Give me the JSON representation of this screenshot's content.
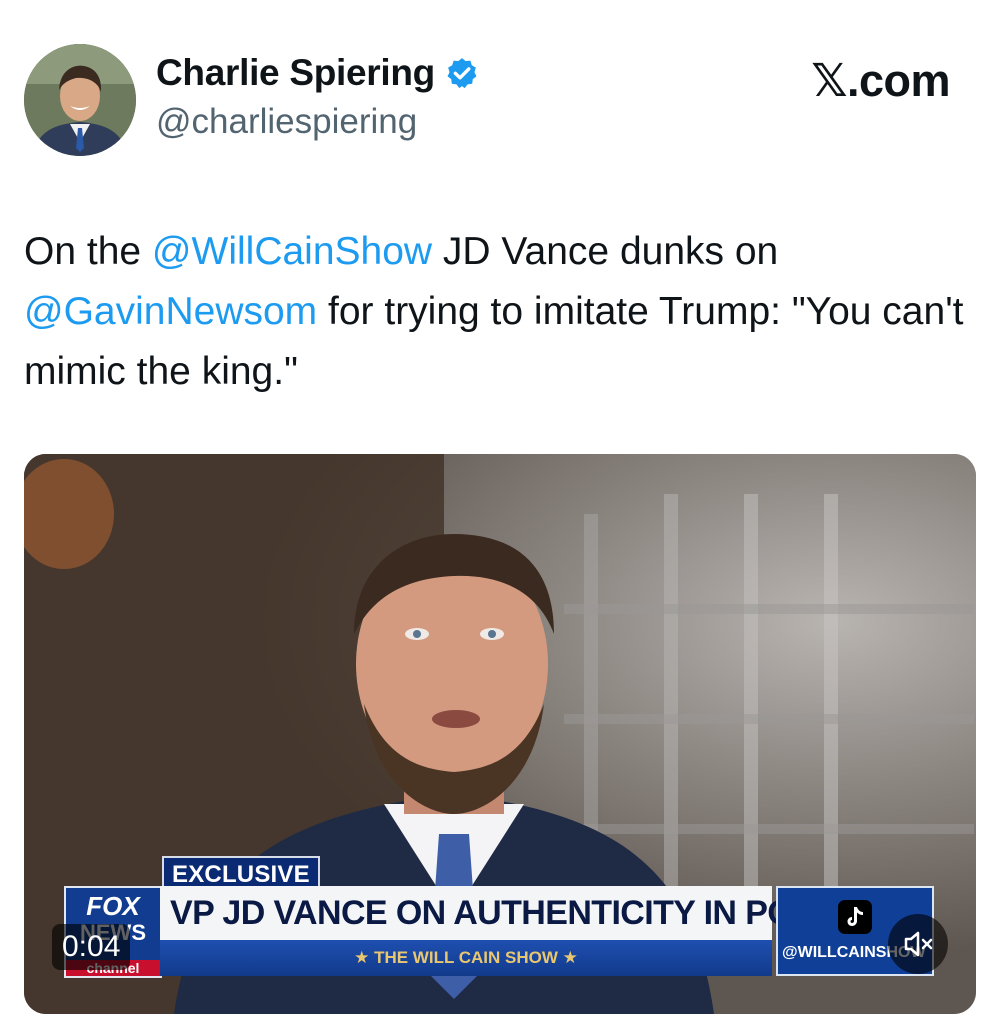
{
  "author": {
    "name": "Charlie Spiering",
    "handle": "@charliespiering",
    "avatar_icon": "person-portrait",
    "verified_icon": "verified-badge-icon"
  },
  "brand": "𝕏.com",
  "tweet": {
    "parts": [
      {
        "text": "On the ",
        "type": "text"
      },
      {
        "text": "@WillCainShow",
        "type": "mention"
      },
      {
        "text": " JD Vance dunks on ",
        "type": "text"
      },
      {
        "text": "@GavinNewsom",
        "type": "mention"
      },
      {
        "text": " for trying to imitate Trump: \"You can't mimic the king.\"",
        "type": "text"
      }
    ]
  },
  "video": {
    "lower_third": {
      "tag": "EXCLUSIVE",
      "headline": "VP JD VANCE ON AUTHENTICITY IN POLITICS",
      "show": "★ THE WILL CAIN SHOW ★",
      "network_top": "FOX",
      "network_mid": "NEWS",
      "network_bottom": "channel"
    },
    "tiktok_handle": "@WILLCAINSHOW",
    "timestamp": "0:04",
    "mute_icon": "muted-speaker-icon"
  },
  "colors": {
    "mention": "#1d9bf0",
    "verified": "#1d9bf0",
    "text": "#0f1419",
    "secondary": "#536471"
  }
}
